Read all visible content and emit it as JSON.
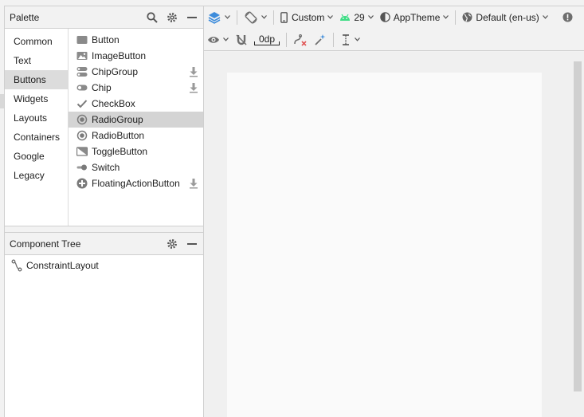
{
  "palette": {
    "title": "Palette",
    "categories": [
      "Common",
      "Text",
      "Buttons",
      "Widgets",
      "Layouts",
      "Containers",
      "Google",
      "Legacy"
    ],
    "selected_category": "Buttons",
    "widgets": [
      {
        "label": "Button",
        "icon": "button-icon"
      },
      {
        "label": "ImageButton",
        "icon": "image-button-icon"
      },
      {
        "label": "ChipGroup",
        "icon": "chip-group-icon",
        "download": true
      },
      {
        "label": "Chip",
        "icon": "chip-icon",
        "download": true
      },
      {
        "label": "CheckBox",
        "icon": "checkmark-icon"
      },
      {
        "label": "RadioGroup",
        "icon": "radio-icon",
        "selected": true
      },
      {
        "label": "RadioButton",
        "icon": "radio-icon"
      },
      {
        "label": "ToggleButton",
        "icon": "toggle-button-icon"
      },
      {
        "label": "Switch",
        "icon": "switch-icon"
      },
      {
        "label": "FloatingActionButton",
        "icon": "plus-circle-icon",
        "download": true
      }
    ]
  },
  "component_tree": {
    "title": "Component Tree",
    "items": [
      {
        "label": "ConstraintLayout",
        "icon": "constraint-layout-icon"
      }
    ]
  },
  "toolbar": {
    "device": "Custom",
    "api_level": "29",
    "theme": "AppTheme",
    "locale": "Default (en-us)",
    "default_margin": "0dp"
  },
  "colors": {
    "accent_blue": "#3d8cdb",
    "android_green": "#3ddc84",
    "error_red": "#e05555",
    "icon_gray": "#6e6e6e"
  }
}
